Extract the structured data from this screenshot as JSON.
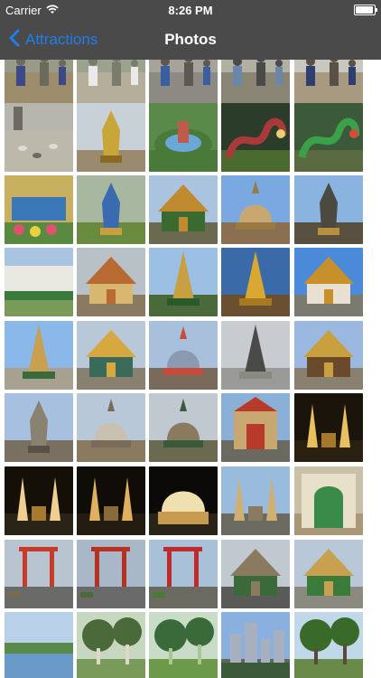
{
  "status_bar": {
    "carrier": "Carrier",
    "time": "8:26 PM",
    "battery_level": 0.95
  },
  "nav_bar": {
    "back_label": "Attractions",
    "title": "Photos"
  },
  "photos": [
    {
      "name": "photo-street-vendors",
      "sky": "#9a9a88",
      "main": "#6c6a5a",
      "accent": "#3b4a86",
      "ground": "#9c8c6c",
      "motif": "people"
    },
    {
      "name": "photo-man-white-shirt",
      "sky": "#9ba38f",
      "main": "#7c7c6e",
      "accent": "#eaeaea",
      "ground": "#b4ae9a",
      "motif": "people"
    },
    {
      "name": "photo-crowd-bench",
      "sky": "#a6a49a",
      "main": "#5c5a50",
      "accent": "#3a5fa0",
      "ground": "#8c8a82",
      "motif": "people"
    },
    {
      "name": "photo-tourists-walking",
      "sky": "#b2b0a2",
      "main": "#4a4a4a",
      "accent": "#6a86a8",
      "ground": "#8a8474",
      "motif": "people"
    },
    {
      "name": "photo-people-market",
      "sky": "#c8c8c0",
      "main": "#5a5046",
      "accent": "#2e3e6e",
      "ground": "#a89a80",
      "motif": "people"
    },
    {
      "name": "photo-pigeons-plaza",
      "sky": "#b6b6ae",
      "main": "#6e6a62",
      "accent": "#dcdcd4",
      "ground": "#bcb8aa",
      "motif": "birds"
    },
    {
      "name": "photo-golden-buddha-statue",
      "sky": "#c8d0d8",
      "main": "#c9a63a",
      "accent": "#8a6a20",
      "ground": "#9a8a70",
      "motif": "statue"
    },
    {
      "name": "photo-garden-sculpture",
      "sky": "#5a8a4a",
      "main": "#c05a4a",
      "accent": "#6aa8d8",
      "ground": "#4a7a3a",
      "motif": "garden"
    },
    {
      "name": "photo-dragon-sculpture",
      "sky": "#2c3c2a",
      "main": "#a83a3a",
      "accent": "#e8d070",
      "ground": "#4a6a30",
      "motif": "dragon"
    },
    {
      "name": "photo-green-dragon",
      "sky": "#3c5a3a",
      "main": "#3aa04a",
      "accent": "#d84a3a",
      "ground": "#5a6a40",
      "motif": "dragon"
    },
    {
      "name": "photo-flower-market",
      "sky": "#c8b060",
      "main": "#3a78b8",
      "accent": "#e05070",
      "ground": "#5a8a40",
      "motif": "flowers"
    },
    {
      "name": "photo-blue-statue-garden",
      "sky": "#a8b8a0",
      "main": "#3a6ab0",
      "accent": "#c8a040",
      "ground": "#6a8a40",
      "motif": "statue"
    },
    {
      "name": "photo-temple-palms",
      "sky": "#aac4e0",
      "main": "#c08a30",
      "accent": "#3a6a30",
      "ground": "#6a6a50",
      "motif": "temple"
    },
    {
      "name": "photo-stupa-dome",
      "sky": "#7aa8e0",
      "main": "#c8a870",
      "accent": "#9a7a40",
      "ground": "#8a7050",
      "motif": "stupa"
    },
    {
      "name": "photo-giant-guardian",
      "sky": "#8ab4e0",
      "main": "#4a4a40",
      "accent": "#b89040",
      "ground": "#5a5040",
      "motif": "statue"
    },
    {
      "name": "photo-palace-wall",
      "sky": "#a8c4e0",
      "main": "#e8e8e0",
      "accent": "#3a7a3a",
      "ground": "#7a9a5a",
      "motif": "wall"
    },
    {
      "name": "photo-pavilion-roof",
      "sky": "#b8c0c8",
      "main": "#b86a30",
      "accent": "#d8b870",
      "ground": "#8a7a60",
      "motif": "temple"
    },
    {
      "name": "photo-golden-spire-trees",
      "sky": "#9cc0e4",
      "main": "#c8a040",
      "accent": "#2a5a2a",
      "ground": "#4a6a3a",
      "motif": "spire"
    },
    {
      "name": "photo-golden-chedi",
      "sky": "#3a6aa8",
      "main": "#d8a830",
      "accent": "#a87a20",
      "ground": "#6a5030",
      "motif": "spire"
    },
    {
      "name": "photo-temple-blue-sky",
      "sky": "#4a8ad8",
      "main": "#c8902a",
      "accent": "#e8e0d0",
      "ground": "#7a7a70",
      "motif": "temple"
    },
    {
      "name": "photo-spires-clear-sky",
      "sky": "#8ab8e8",
      "main": "#c8a050",
      "accent": "#3a6a3a",
      "ground": "#a8a090",
      "motif": "spire"
    },
    {
      "name": "photo-ornate-pavilion",
      "sky": "#b8c8d8",
      "main": "#d8a840",
      "accent": "#3a6a5a",
      "ground": "#8a8070",
      "motif": "temple"
    },
    {
      "name": "photo-porcelain-prang",
      "sky": "#a8c0dc",
      "main": "#8a9ab0",
      "accent": "#c84a3a",
      "ground": "#7a6a5a",
      "motif": "stupa"
    },
    {
      "name": "photo-spire-closeup",
      "sky": "#c8ccd0",
      "main": "#4a4a48",
      "accent": "#8a8a80",
      "ground": "#9a9a98",
      "motif": "spire"
    },
    {
      "name": "photo-hall-gold-trim",
      "sky": "#9ab8e0",
      "main": "#c8a040",
      "accent": "#6a4a2a",
      "ground": "#8a8070",
      "motif": "temple"
    },
    {
      "name": "photo-stone-guardian",
      "sky": "#a8c0e0",
      "main": "#8a8270",
      "accent": "#5a5048",
      "ground": "#7a7060",
      "motif": "statue"
    },
    {
      "name": "photo-white-prang",
      "sky": "#b8c8d8",
      "main": "#c8c0b0",
      "accent": "#7a6a5a",
      "ground": "#8a7a60",
      "motif": "stupa"
    },
    {
      "name": "photo-chedi-garden",
      "sky": "#c0c8d0",
      "main": "#8a7a60",
      "accent": "#3a5a3a",
      "ground": "#6a6a50",
      "motif": "stupa"
    },
    {
      "name": "photo-red-gate-towers",
      "sky": "#8ab0d8",
      "main": "#b83a2a",
      "accent": "#c8a870",
      "ground": "#6a6a60",
      "motif": "gate"
    },
    {
      "name": "photo-monument-night",
      "sky": "#1a140a",
      "main": "#e8c060",
      "accent": "#a8782a",
      "ground": "#2a2010",
      "motif": "monument"
    },
    {
      "name": "photo-lit-wings-night",
      "sky": "#141008",
      "main": "#f0d090",
      "accent": "#a87a30",
      "ground": "#2a2418",
      "motif": "monument"
    },
    {
      "name": "photo-monument-wings-dark",
      "sky": "#100c08",
      "main": "#e0b060",
      "accent": "#8a6a3a",
      "ground": "#241c10",
      "motif": "monument"
    },
    {
      "name": "photo-lit-dome-night",
      "sky": "#0c0a08",
      "main": "#f0e0b0",
      "accent": "#c89a50",
      "ground": "#2a2418",
      "motif": "dome"
    },
    {
      "name": "photo-democracy-monument",
      "sky": "#9abcdc",
      "main": "#d0b070",
      "accent": "#8a7a60",
      "ground": "#6a6a60",
      "motif": "monument"
    },
    {
      "name": "photo-arched-hall",
      "sky": "#c8c0a8",
      "main": "#e8e0c8",
      "accent": "#3a8a4a",
      "ground": "#a89878",
      "motif": "arch"
    },
    {
      "name": "photo-giant-swing",
      "sky": "#b8c4d0",
      "main": "#c83a2a",
      "accent": "#7a6a50",
      "ground": "#6a6a68",
      "motif": "swing"
    },
    {
      "name": "photo-swing-street",
      "sky": "#a8b8c8",
      "main": "#b83020",
      "accent": "#4a6a3a",
      "ground": "#6a6a6a",
      "motif": "swing"
    },
    {
      "name": "photo-red-pillars",
      "sky": "#a8c0d8",
      "main": "#c02a2a",
      "accent": "#4a7a3a",
      "ground": "#6a6a60",
      "motif": "swing"
    },
    {
      "name": "photo-city-square",
      "sky": "#c0c8d0",
      "main": "#8a7a60",
      "accent": "#3a6a3a",
      "ground": "#5a5a58",
      "motif": "temple"
    },
    {
      "name": "photo-temple-courtyard",
      "sky": "#b8c8d8",
      "main": "#c8a050",
      "accent": "#3a7a3a",
      "ground": "#8a8a80",
      "motif": "temple"
    },
    {
      "name": "photo-lake-view",
      "sky": "#b8d0e8",
      "main": "#5a8a4a",
      "accent": "#6a9ac8",
      "ground": "#3a6a3a",
      "motif": "lake"
    },
    {
      "name": "photo-park-visitor",
      "sky": "#c8d8c0",
      "main": "#4a6a3a",
      "accent": "#e0d8c8",
      "ground": "#7a9a5a",
      "motif": "park"
    },
    {
      "name": "photo-park-trees",
      "sky": "#c8dcc8",
      "main": "#3a6a3a",
      "accent": "#a8c890",
      "ground": "#6a9a4a",
      "motif": "park"
    },
    {
      "name": "photo-city-skyline",
      "sky": "#8ab0e0",
      "main": "#a8b0c0",
      "accent": "#3a5a3a",
      "ground": "#5a6a5a",
      "motif": "city"
    },
    {
      "name": "photo-large-tree",
      "sky": "#c0d8e8",
      "main": "#3a6a2a",
      "accent": "#5a4a3a",
      "ground": "#6a8a4a",
      "motif": "park"
    }
  ]
}
